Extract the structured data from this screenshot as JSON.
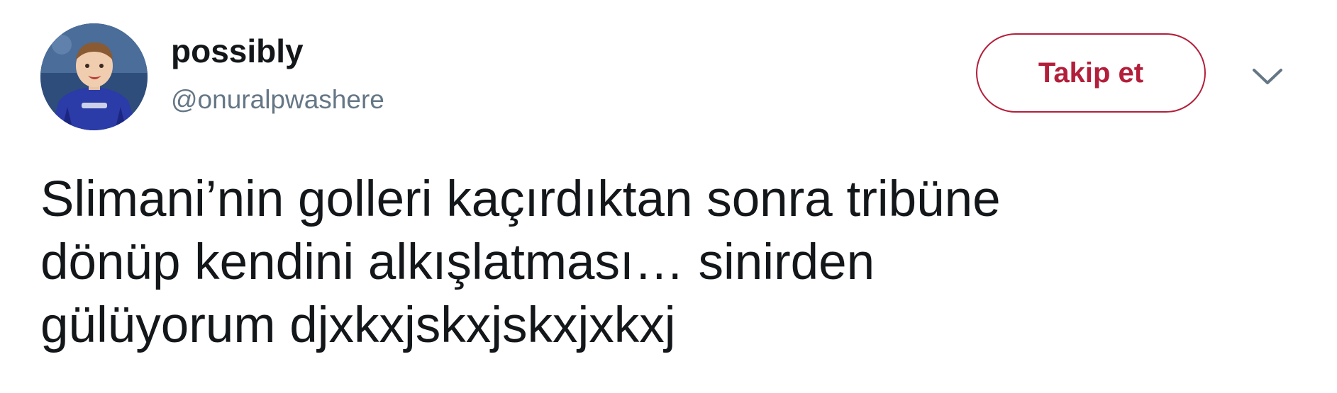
{
  "author": {
    "display_name": "possibly",
    "handle": "@onuralpwashere"
  },
  "follow_button": {
    "label": "Takip et"
  },
  "menu": {
    "icon": "chevron-down-icon"
  },
  "tweet": {
    "lines": [
      "Slimani’nin golleri kaçırdıktan sonra tribüne",
      "dönüp kendini alkışlatması… sinirden",
      "gülüyorum djxkxjskxjskxjxkxj"
    ]
  },
  "colors": {
    "accent": "#b31f3b",
    "text": "#14171a",
    "secondary_text": "#657786",
    "background": "#ffffff"
  }
}
